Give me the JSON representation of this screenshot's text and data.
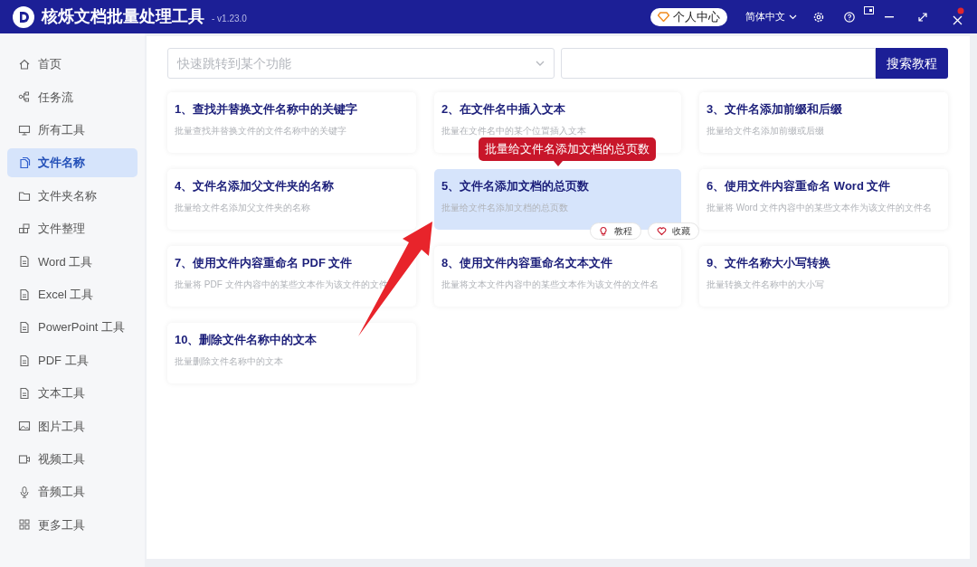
{
  "window": {
    "title": "核烁文档批量处理工具",
    "version": "- v1.23.0",
    "user_center": "个人中心",
    "language": "简体中文"
  },
  "sidebar": {
    "items": [
      {
        "label": "首页",
        "selected": false
      },
      {
        "label": "任务流",
        "selected": false
      },
      {
        "label": "所有工具",
        "selected": false
      },
      {
        "label": "文件名称",
        "selected": true
      },
      {
        "label": "文件夹名称",
        "selected": false
      },
      {
        "label": "文件整理",
        "selected": false
      },
      {
        "label": "Word 工具",
        "selected": false
      },
      {
        "label": "Excel 工具",
        "selected": false
      },
      {
        "label": "PowerPoint 工具",
        "selected": false
      },
      {
        "label": "PDF 工具",
        "selected": false
      },
      {
        "label": "文本工具",
        "selected": false
      },
      {
        "label": "图片工具",
        "selected": false
      },
      {
        "label": "视频工具",
        "selected": false
      },
      {
        "label": "音频工具",
        "selected": false
      },
      {
        "label": "更多工具",
        "selected": false
      }
    ]
  },
  "search": {
    "placeholder": "快速跳转到某个功能",
    "button": "搜索教程"
  },
  "cards": [
    {
      "title": "1、查找并替换文件名称中的关键字",
      "description": "批量查找并替换文件的文件名称中的关键字",
      "selected": false
    },
    {
      "title": "2、在文件名中插入文本",
      "description": "批量在文件名中的某个位置插入文本",
      "selected": false
    },
    {
      "title": "3、文件名添加前缀和后缀",
      "description": "批量给文件名添加前缀或后缀",
      "selected": false
    },
    {
      "title": "4、文件名添加父文件夹的名称",
      "description": "批量给文件名添加父文件夹的名称",
      "selected": false
    },
    {
      "title": "5、文件名添加文档的总页数",
      "description": "批量给文件名添加文档的总页数",
      "selected": true,
      "tooltip": "批量给文件名添加文档的总页数",
      "actions": [
        "教程",
        "收藏"
      ]
    },
    {
      "title": "6、使用文件内容重命名 Word 文件",
      "description": "批量将 Word 文件内容中的某些文本作为该文件的文件名",
      "selected": false
    },
    {
      "title": "7、使用文件内容重命名 PDF 文件",
      "description": "批量将 PDF 文件内容中的某些文本作为该文件的文件",
      "selected": false
    },
    {
      "title": "8、使用文件内容重命名文本文件",
      "description": "批量将文本文件内容中的某些文本作为该文件的文件名",
      "selected": false
    },
    {
      "title": "9、文件名称大小写转换",
      "description": "批量转换文件名称中的大小写",
      "selected": false
    },
    {
      "title": "10、删除文件名称中的文本",
      "description": "批量删除文件名称中的文本",
      "selected": false
    }
  ]
}
